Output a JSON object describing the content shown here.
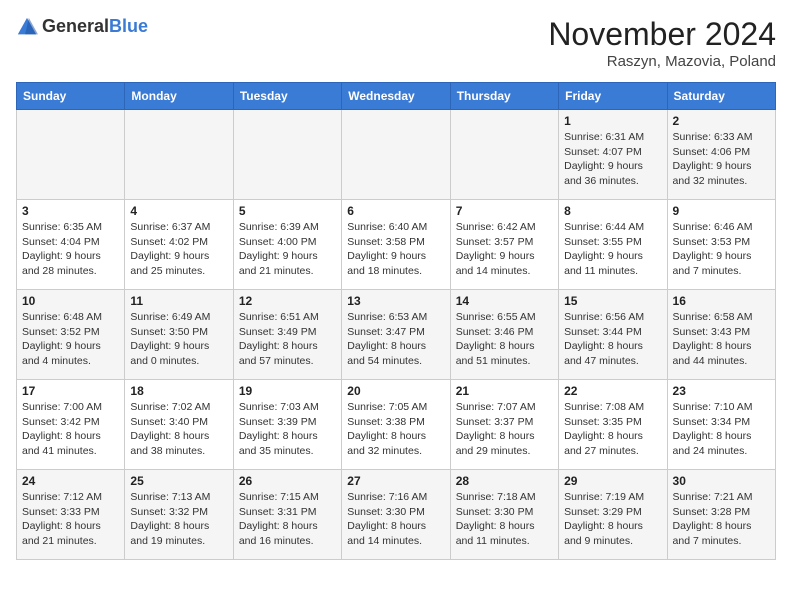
{
  "header": {
    "logo_general": "General",
    "logo_blue": "Blue",
    "title": "November 2024",
    "subtitle": "Raszyn, Mazovia, Poland"
  },
  "days_of_week": [
    "Sunday",
    "Monday",
    "Tuesday",
    "Wednesday",
    "Thursday",
    "Friday",
    "Saturday"
  ],
  "weeks": [
    [
      {
        "day": "",
        "info": ""
      },
      {
        "day": "",
        "info": ""
      },
      {
        "day": "",
        "info": ""
      },
      {
        "day": "",
        "info": ""
      },
      {
        "day": "",
        "info": ""
      },
      {
        "day": "1",
        "info": "Sunrise: 6:31 AM\nSunset: 4:07 PM\nDaylight: 9 hours and 36 minutes."
      },
      {
        "day": "2",
        "info": "Sunrise: 6:33 AM\nSunset: 4:06 PM\nDaylight: 9 hours and 32 minutes."
      }
    ],
    [
      {
        "day": "3",
        "info": "Sunrise: 6:35 AM\nSunset: 4:04 PM\nDaylight: 9 hours and 28 minutes."
      },
      {
        "day": "4",
        "info": "Sunrise: 6:37 AM\nSunset: 4:02 PM\nDaylight: 9 hours and 25 minutes."
      },
      {
        "day": "5",
        "info": "Sunrise: 6:39 AM\nSunset: 4:00 PM\nDaylight: 9 hours and 21 minutes."
      },
      {
        "day": "6",
        "info": "Sunrise: 6:40 AM\nSunset: 3:58 PM\nDaylight: 9 hours and 18 minutes."
      },
      {
        "day": "7",
        "info": "Sunrise: 6:42 AM\nSunset: 3:57 PM\nDaylight: 9 hours and 14 minutes."
      },
      {
        "day": "8",
        "info": "Sunrise: 6:44 AM\nSunset: 3:55 PM\nDaylight: 9 hours and 11 minutes."
      },
      {
        "day": "9",
        "info": "Sunrise: 6:46 AM\nSunset: 3:53 PM\nDaylight: 9 hours and 7 minutes."
      }
    ],
    [
      {
        "day": "10",
        "info": "Sunrise: 6:48 AM\nSunset: 3:52 PM\nDaylight: 9 hours and 4 minutes."
      },
      {
        "day": "11",
        "info": "Sunrise: 6:49 AM\nSunset: 3:50 PM\nDaylight: 9 hours and 0 minutes."
      },
      {
        "day": "12",
        "info": "Sunrise: 6:51 AM\nSunset: 3:49 PM\nDaylight: 8 hours and 57 minutes."
      },
      {
        "day": "13",
        "info": "Sunrise: 6:53 AM\nSunset: 3:47 PM\nDaylight: 8 hours and 54 minutes."
      },
      {
        "day": "14",
        "info": "Sunrise: 6:55 AM\nSunset: 3:46 PM\nDaylight: 8 hours and 51 minutes."
      },
      {
        "day": "15",
        "info": "Sunrise: 6:56 AM\nSunset: 3:44 PM\nDaylight: 8 hours and 47 minutes."
      },
      {
        "day": "16",
        "info": "Sunrise: 6:58 AM\nSunset: 3:43 PM\nDaylight: 8 hours and 44 minutes."
      }
    ],
    [
      {
        "day": "17",
        "info": "Sunrise: 7:00 AM\nSunset: 3:42 PM\nDaylight: 8 hours and 41 minutes."
      },
      {
        "day": "18",
        "info": "Sunrise: 7:02 AM\nSunset: 3:40 PM\nDaylight: 8 hours and 38 minutes."
      },
      {
        "day": "19",
        "info": "Sunrise: 7:03 AM\nSunset: 3:39 PM\nDaylight: 8 hours and 35 minutes."
      },
      {
        "day": "20",
        "info": "Sunrise: 7:05 AM\nSunset: 3:38 PM\nDaylight: 8 hours and 32 minutes."
      },
      {
        "day": "21",
        "info": "Sunrise: 7:07 AM\nSunset: 3:37 PM\nDaylight: 8 hours and 29 minutes."
      },
      {
        "day": "22",
        "info": "Sunrise: 7:08 AM\nSunset: 3:35 PM\nDaylight: 8 hours and 27 minutes."
      },
      {
        "day": "23",
        "info": "Sunrise: 7:10 AM\nSunset: 3:34 PM\nDaylight: 8 hours and 24 minutes."
      }
    ],
    [
      {
        "day": "24",
        "info": "Sunrise: 7:12 AM\nSunset: 3:33 PM\nDaylight: 8 hours and 21 minutes."
      },
      {
        "day": "25",
        "info": "Sunrise: 7:13 AM\nSunset: 3:32 PM\nDaylight: 8 hours and 19 minutes."
      },
      {
        "day": "26",
        "info": "Sunrise: 7:15 AM\nSunset: 3:31 PM\nDaylight: 8 hours and 16 minutes."
      },
      {
        "day": "27",
        "info": "Sunrise: 7:16 AM\nSunset: 3:30 PM\nDaylight: 8 hours and 14 minutes."
      },
      {
        "day": "28",
        "info": "Sunrise: 7:18 AM\nSunset: 3:30 PM\nDaylight: 8 hours and 11 minutes."
      },
      {
        "day": "29",
        "info": "Sunrise: 7:19 AM\nSunset: 3:29 PM\nDaylight: 8 hours and 9 minutes."
      },
      {
        "day": "30",
        "info": "Sunrise: 7:21 AM\nSunset: 3:28 PM\nDaylight: 8 hours and 7 minutes."
      }
    ]
  ]
}
